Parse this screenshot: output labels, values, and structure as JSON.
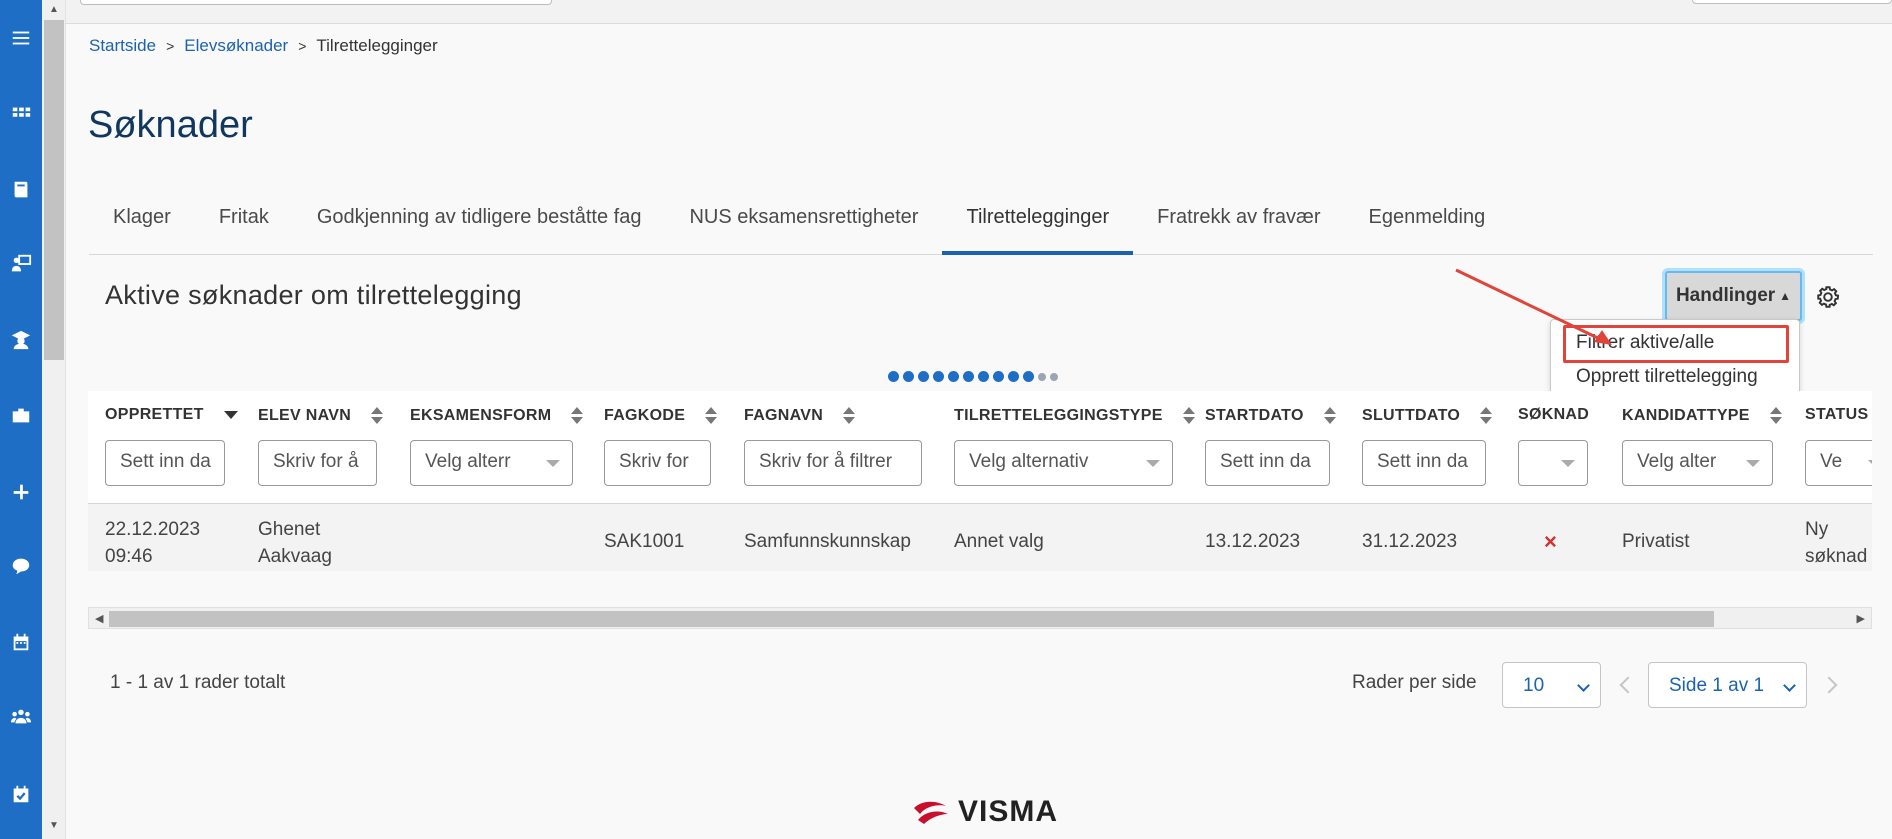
{
  "breadcrumb": {
    "home": "Startside",
    "parent": "Elevsøknader",
    "current": "Tilrettelegginger"
  },
  "page_title": "Søknader",
  "tabs": [
    "Klager",
    "Fritak",
    "Godkjenning av tidligere beståtte fag",
    "NUS eksamensrettigheter",
    "Tilrettelegginger",
    "Fratrekk av fravær",
    "Egenmelding"
  ],
  "active_tab": "Tilrettelegginger",
  "section_title": "Aktive søknader om tilrettelegging",
  "actions": {
    "label": "Handlinger",
    "menu": [
      "Filtrer aktive/alle",
      "Opprett tilrettelegging"
    ]
  },
  "table": {
    "columns": [
      "OPPRETTET",
      "ELEV NAVN",
      "EKSAMENSFORM",
      "FAGKODE",
      "FAGNAVN",
      "TILRETTELEGGINGSTYPE",
      "STARTDATO",
      "SLUTTDATO",
      "SØKNAD",
      "KANDIDATTYPE",
      "STATUS"
    ],
    "filters": [
      "Sett inn da",
      "Skriv for å",
      "Velg alterr",
      "Skriv for",
      "Skriv for å filtrer",
      "Velg alternativ",
      "Sett inn da",
      "Sett inn da",
      "",
      "Velg alter",
      "Ve"
    ],
    "rows": [
      {
        "opprettet_date": "22.12.2023",
        "opprettet_time": "09:46",
        "elev_first": "Ghenet",
        "elev_last": "Aakvaag",
        "eksamensform": "",
        "fagkode": "SAK1001",
        "fagnavn": "Samfunnskunnskap",
        "type": "Annet valg",
        "start": "13.12.2023",
        "slutt": "31.12.2023",
        "soknad": "×",
        "kandidattype": "Privatist",
        "status_1": "Ny",
        "status_2": "søknad"
      }
    ]
  },
  "pagination": {
    "summary": "1 - 1 av 1 rader totalt",
    "rows_label": "Rader per side",
    "rows_per_page": "10",
    "page": "Side 1 av 1"
  },
  "footer_logo": "VISMA",
  "colors": {
    "brand_blue": "#1e6ec6",
    "link": "#1c62b2",
    "annotation_red": "#e0443a",
    "error_red": "#d0312d"
  }
}
